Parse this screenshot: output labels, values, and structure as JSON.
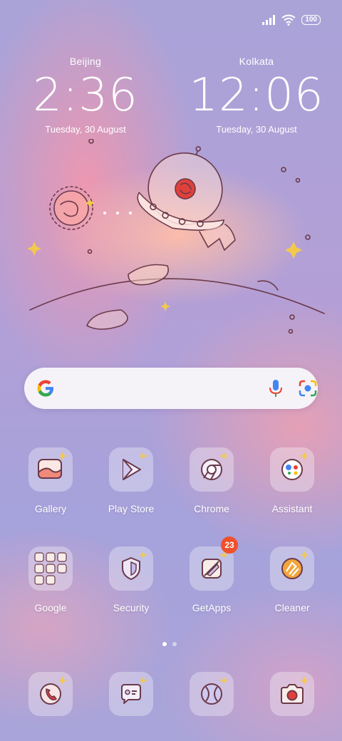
{
  "status": {
    "battery": "100",
    "signal_icon": "signal-icon",
    "wifi_icon": "wifi-icon"
  },
  "clocks": [
    {
      "city": "Beijing",
      "time": "2:36",
      "date": "Tuesday, 30 August"
    },
    {
      "city": "Kolkata",
      "time": "12:06",
      "date": "Tuesday, 30 August"
    }
  ],
  "search": {
    "google_icon": "google-logo-icon",
    "mic_icon": "mic-icon",
    "lens_icon": "camera-lens-icon"
  },
  "apps_row1": [
    {
      "label": "Gallery",
      "icon": "gallery-icon"
    },
    {
      "label": "Play Store",
      "icon": "play-store-icon"
    },
    {
      "label": "Chrome",
      "icon": "chrome-icon"
    },
    {
      "label": "Assistant",
      "icon": "assistant-icon"
    }
  ],
  "apps_row2": [
    {
      "label": "Google",
      "icon": "google-folder-icon"
    },
    {
      "label": "Security",
      "icon": "shield-icon"
    },
    {
      "label": "GetApps",
      "icon": "getapps-icon",
      "badge": "23"
    },
    {
      "label": "Cleaner",
      "icon": "cleaner-icon"
    }
  ],
  "dock": [
    {
      "icon": "phone-icon"
    },
    {
      "icon": "messages-icon"
    },
    {
      "icon": "browser-icon"
    },
    {
      "icon": "camera-icon"
    }
  ],
  "pages": {
    "count": 2,
    "current": 1
  },
  "colors": {
    "accent_badge": "#f0502a",
    "icon_stroke": "#6b3a4a"
  }
}
